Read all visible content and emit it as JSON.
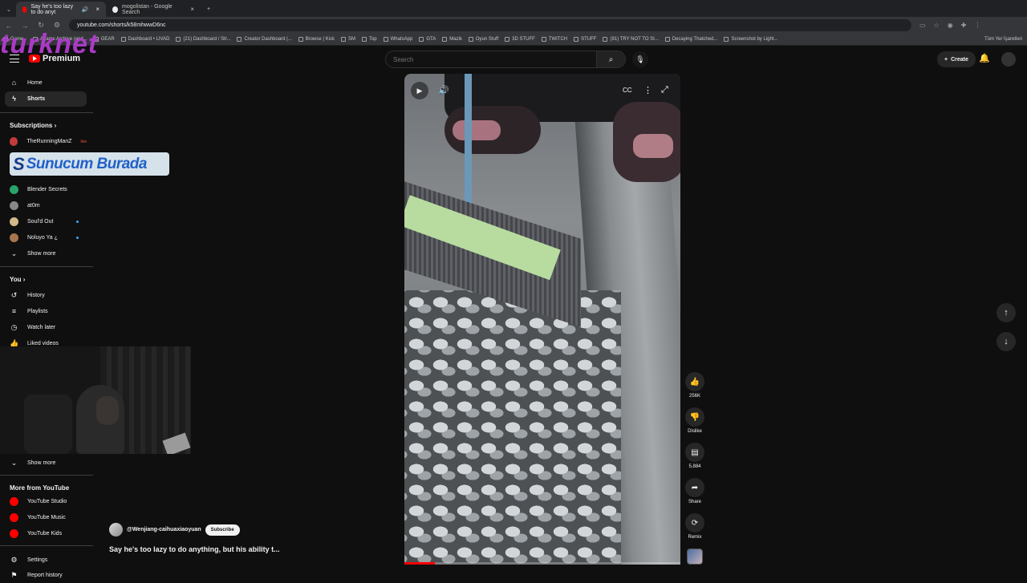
{
  "browser": {
    "tabs": [
      {
        "title": "Say he's too lazy to do anyt",
        "active": true
      },
      {
        "title": "mogolistan - Google Search",
        "active": false
      }
    ],
    "url": "youtube.com/shorts/k58mhwwD6nc",
    "bookmarks": [
      "Game -",
      "Adams Archive (and...",
      "GEAR",
      "Dashboard • LIVAD",
      "(21) Dashboard / Str...",
      "Creator Dashboard |...",
      "Browse | Kick",
      "SM",
      "Top",
      "WhatsApp",
      "GTA",
      "Mazik",
      "Oyun Stuff",
      "3D STUFF",
      "TWITCH",
      "STUFF",
      "(91) TRY NOT TO SI...",
      "Decaying Thatched...",
      "Screenshot by Light..."
    ],
    "bookmarks_right": "Tüm Yer İşaretleri"
  },
  "watermark": "turknet",
  "youtube": {
    "logo_text": "Premium",
    "search_placeholder": "Search",
    "create_label": "Create"
  },
  "sidebar": {
    "home": "Home",
    "shorts": "Shorts",
    "subscriptions_header": "Subscriptions",
    "subscriptions": [
      "TheRunningManZ",
      "Blender Secrets",
      "at0m",
      "Soul'd Out",
      "Noluyo Ya ¿"
    ],
    "live_badge": "live",
    "show_more_1": "Show more",
    "you_header": "You",
    "you_items": [
      "History",
      "Playlists",
      "Watch later",
      "Liked videos"
    ],
    "show_more_2": "Show more",
    "more_header": "More from YouTube",
    "more_items": [
      "YouTube Studio",
      "YouTube Music",
      "YouTube Kids"
    ],
    "settings": "Settings",
    "report": "Report history"
  },
  "banner": {
    "letter": "S",
    "text": "Sunucum Burada"
  },
  "short": {
    "channel": "@Wenjiang-caihuaxiaoyuan",
    "subscribe": "Subscribe",
    "title": "Say he's too lazy to do anything, but his ability t...",
    "likes": "256K",
    "dislike": "Dislike",
    "comments": "5,884",
    "share": "Share",
    "remix": "Remix",
    "progress_fraction": 0.11
  }
}
